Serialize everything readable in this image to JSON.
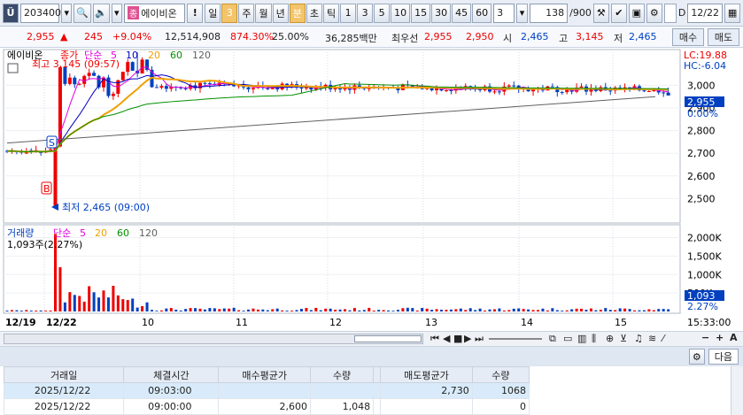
{
  "toolbar": {
    "code": "203400",
    "name_badge": "종",
    "name": "에이비온",
    "period_buttons": [
      "일",
      "3",
      "주",
      "월",
      "년",
      "분",
      "초",
      "틱",
      "1",
      "3",
      "5",
      "10",
      "15",
      "30",
      "45",
      "60"
    ],
    "selected_period": "분",
    "interval_select": "3",
    "count": "138",
    "total": "/900",
    "date_check": "D",
    "date": "12/22"
  },
  "quote": {
    "price": "2,955",
    "change": "245",
    "change_pct": "+9.04%",
    "volume": "12,514,908",
    "vol_ratio": "874.30%",
    "turnover": "25.00%",
    "amount": "36,285백만",
    "best_label": "최우선",
    "best_ask": "2,955",
    "best_bid": "2,950",
    "open_label": "시",
    "open": "2,465",
    "high_label": "고",
    "high": "3,145",
    "low_label": "저",
    "low": "2,465",
    "buy_btn": "매수",
    "sell_btn": "매도"
  },
  "price_panel": {
    "name": "에이비온",
    "legend_label": "종가",
    "ma_label": "단순",
    "ma_periods": [
      "5",
      "10",
      "20",
      "60",
      "120"
    ],
    "ma_colors": [
      "#e000e0",
      "#0000c0",
      "#f0a000",
      "#009000",
      "#606060"
    ],
    "lc": "LC:19.88",
    "hc": "HC:-6.04",
    "high_note": "최고 3,145 (09:57)",
    "low_note": "최저 2,465 (09:00)",
    "y_ticks": [
      "3,000",
      "2,900",
      "2,800",
      "2,700",
      "2,600",
      "2,500"
    ],
    "current_price": "2,955",
    "current_pct": "0.00%",
    "buy_marker": "S",
    "sell_marker": "B"
  },
  "volume_panel": {
    "label": "거래량",
    "ma_label": "단순",
    "ma_periods": [
      "5",
      "20",
      "60",
      "120"
    ],
    "ma_colors": [
      "#e000e0",
      "#f0a000",
      "#009000",
      "#606060"
    ],
    "last": "1,093주(2.27%)",
    "y_ticks": [
      "2,000K",
      "1,500K",
      "1,000K",
      "500K"
    ],
    "current": "1,093",
    "current_pct": "2.27%"
  },
  "x_axis": {
    "labels": [
      "12/19",
      "12/22",
      "10",
      "11",
      "12",
      "13",
      "14",
      "15"
    ],
    "time": "15:33:00"
  },
  "grid": {
    "next_btn": "다음",
    "columns": [
      "거래일",
      "체결시간",
      "매수평균가",
      "수량",
      "",
      "매도평균가",
      "수량"
    ],
    "rows": [
      [
        "2025/12/22",
        "09:03:00",
        "",
        "",
        "",
        "2,730",
        "1068"
      ],
      [
        "2025/12/22",
        "09:00:00",
        "2,600",
        "1,048",
        "",
        "",
        "0"
      ]
    ]
  },
  "chart_data": {
    "type": "candlestick",
    "price_series_summary": {
      "open": 2465,
      "high": 3145,
      "low": 2465,
      "last": 2955,
      "ylim": [
        2400,
        3150
      ]
    },
    "volume_ylim": [
      0,
      2300
    ]
  }
}
